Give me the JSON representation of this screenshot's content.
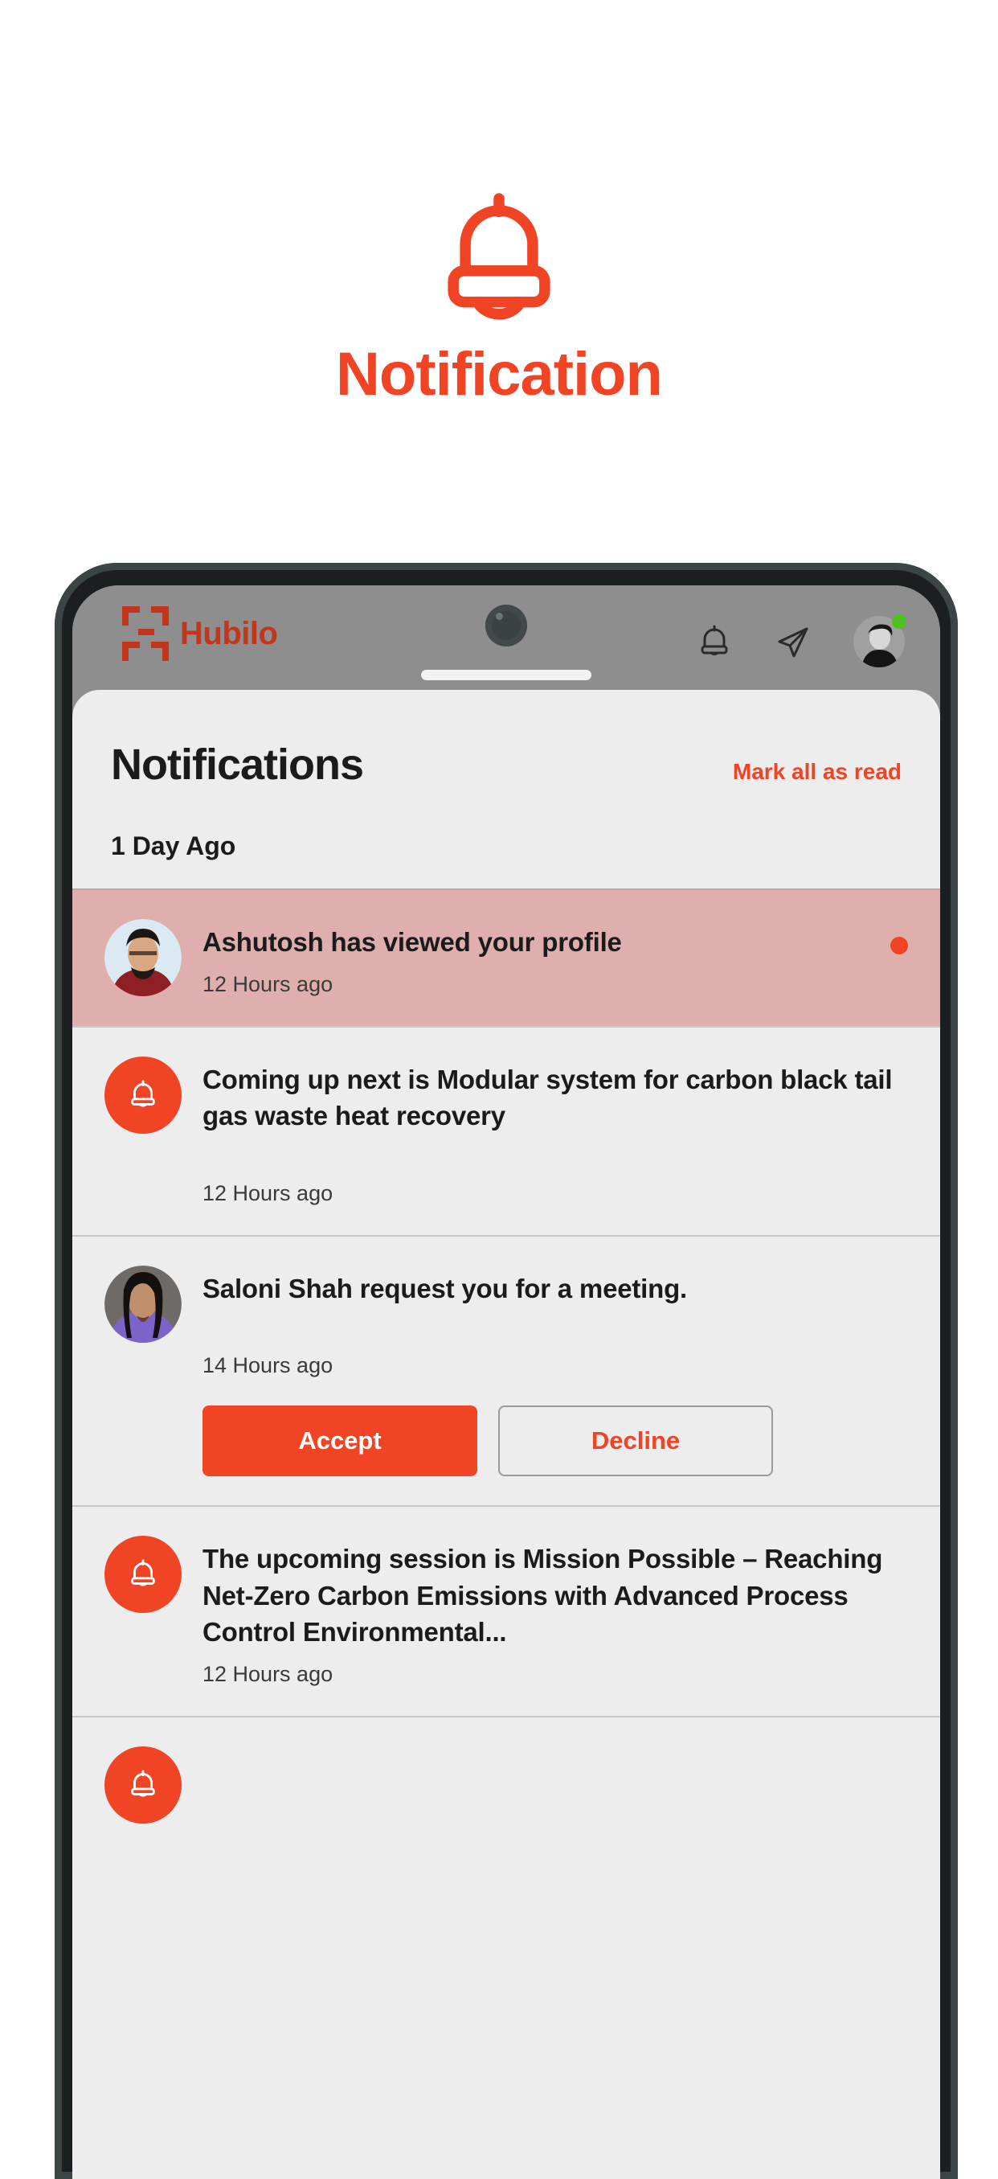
{
  "hero": {
    "icon": "bell-icon",
    "title": "Notification",
    "accent_color": "#F04425"
  },
  "phone": {
    "app_header": {
      "brand_mark": "hubilo-logo-icon",
      "brand_name": "Hubilo",
      "icons": [
        {
          "name": "bell-icon"
        },
        {
          "name": "paper-plane-icon"
        },
        {
          "name": "avatar",
          "status": "online",
          "status_color": "#4cc21c"
        }
      ]
    },
    "sheet": {
      "title": "Notifications",
      "mark_all_label": "Mark all as read",
      "section_label": "1 Day Ago",
      "notifications": [
        {
          "avatar_type": "photo-male",
          "text": "Ashutosh has viewed your profile",
          "time": "12 Hours ago",
          "unread": true,
          "has_actions": false
        },
        {
          "avatar_type": "bell",
          "text": "Coming up next is Modular system for carbon black tail gas waste heat recovery",
          "time": "12 Hours ago",
          "unread": false,
          "has_actions": false
        },
        {
          "avatar_type": "photo-female",
          "text": "Saloni Shah request you for a meeting.",
          "time": "14 Hours ago",
          "unread": false,
          "has_actions": true,
          "accept_label": "Accept",
          "decline_label": "Decline"
        },
        {
          "avatar_type": "bell",
          "text": "The upcoming session is Mission Possible – Reaching Net-Zero Carbon Emissions with Advanced Process Control Environmental...",
          "time": "12 Hours ago",
          "unread": false,
          "has_actions": false
        },
        {
          "avatar_type": "bell",
          "text": "",
          "time": "",
          "unread": false,
          "has_actions": false,
          "partial": true
        }
      ]
    }
  },
  "colors": {
    "accent": "#F04425",
    "unread_row_bg": "#dfafae",
    "sheet_bg": "#ededed",
    "status_bar_bg": "#8e8e8e"
  }
}
